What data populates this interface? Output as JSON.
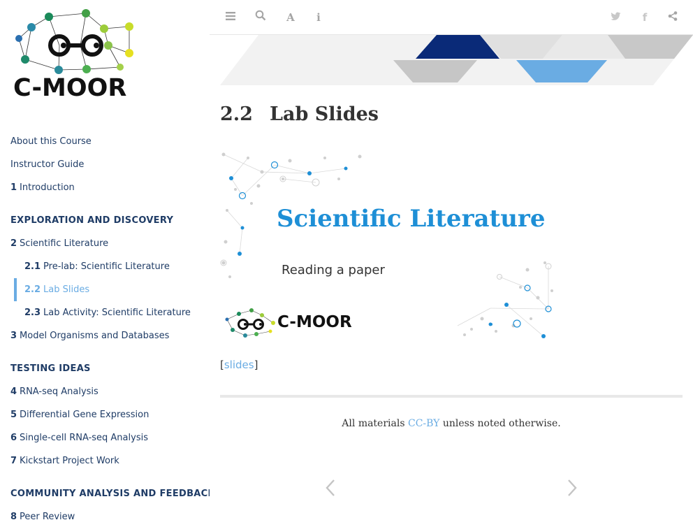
{
  "sidebar": {
    "logo_text": "C-MOOR",
    "items": [
      {
        "num": "",
        "label": "About this Course"
      },
      {
        "num": "",
        "label": "Instructor Guide"
      },
      {
        "num": "1",
        "label": "Introduction"
      },
      {
        "part": "EXPLORATION AND DISCOVERY"
      },
      {
        "num": "2",
        "label": "Scientific Literature"
      },
      {
        "num": "2.1",
        "label": "Pre-lab: Scientific Literature"
      },
      {
        "num": "2.2",
        "label": "Lab Slides"
      },
      {
        "num": "2.3",
        "label": "Lab Activity: Scientific Literature"
      },
      {
        "num": "3",
        "label": "Model Organisms and Databases"
      },
      {
        "part": "TESTING IDEAS"
      },
      {
        "num": "4",
        "label": "RNA-seq Analysis"
      },
      {
        "num": "5",
        "label": "Differential Gene Expression"
      },
      {
        "num": "6",
        "label": "Single-cell RNA-seq Analysis"
      },
      {
        "num": "7",
        "label": "Kickstart Project Work"
      },
      {
        "part": "COMMUNITY ANALYSIS AND FEEDBACK"
      },
      {
        "num": "8",
        "label": "Peer Review"
      }
    ]
  },
  "toolbar": {
    "icons": [
      "menu-icon",
      "search-icon",
      "font-icon",
      "info-icon",
      "twitter-icon",
      "facebook-icon",
      "share-icon"
    ]
  },
  "main": {
    "title_num": "2.2",
    "title": "Lab Slides",
    "slide": {
      "title": "Scientific Literature",
      "subtitle": "Reading a paper",
      "logo_text": "C-MOOR"
    },
    "link_open": "[",
    "link_label": "slides",
    "link_close": "]",
    "footer_prefix": "All materials ",
    "footer_link": "CC-BY",
    "footer_suffix": " unless noted otherwise."
  },
  "colors": {
    "navy": "#1f3c66",
    "accent": "#6aace3",
    "slide_title": "#1e8fd6",
    "banner_dark": "#0a2a78",
    "banner_light": "#6aace3"
  }
}
